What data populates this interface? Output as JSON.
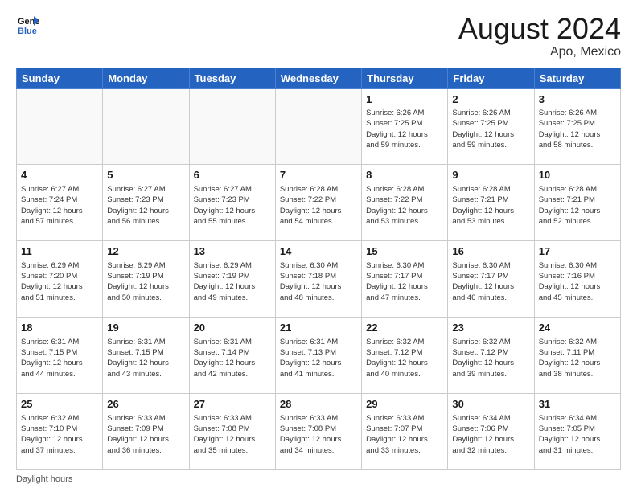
{
  "header": {
    "logo_line1": "General",
    "logo_line2": "Blue",
    "month_year": "August 2024",
    "location": "Apo, Mexico"
  },
  "footer": {
    "daylight_label": "Daylight hours"
  },
  "days_of_week": [
    "Sunday",
    "Monday",
    "Tuesday",
    "Wednesday",
    "Thursday",
    "Friday",
    "Saturday"
  ],
  "weeks": [
    [
      {
        "num": "",
        "info": ""
      },
      {
        "num": "",
        "info": ""
      },
      {
        "num": "",
        "info": ""
      },
      {
        "num": "",
        "info": ""
      },
      {
        "num": "1",
        "info": "Sunrise: 6:26 AM\nSunset: 7:25 PM\nDaylight: 12 hours\nand 59 minutes."
      },
      {
        "num": "2",
        "info": "Sunrise: 6:26 AM\nSunset: 7:25 PM\nDaylight: 12 hours\nand 59 minutes."
      },
      {
        "num": "3",
        "info": "Sunrise: 6:26 AM\nSunset: 7:25 PM\nDaylight: 12 hours\nand 58 minutes."
      }
    ],
    [
      {
        "num": "4",
        "info": "Sunrise: 6:27 AM\nSunset: 7:24 PM\nDaylight: 12 hours\nand 57 minutes."
      },
      {
        "num": "5",
        "info": "Sunrise: 6:27 AM\nSunset: 7:23 PM\nDaylight: 12 hours\nand 56 minutes."
      },
      {
        "num": "6",
        "info": "Sunrise: 6:27 AM\nSunset: 7:23 PM\nDaylight: 12 hours\nand 55 minutes."
      },
      {
        "num": "7",
        "info": "Sunrise: 6:28 AM\nSunset: 7:22 PM\nDaylight: 12 hours\nand 54 minutes."
      },
      {
        "num": "8",
        "info": "Sunrise: 6:28 AM\nSunset: 7:22 PM\nDaylight: 12 hours\nand 53 minutes."
      },
      {
        "num": "9",
        "info": "Sunrise: 6:28 AM\nSunset: 7:21 PM\nDaylight: 12 hours\nand 53 minutes."
      },
      {
        "num": "10",
        "info": "Sunrise: 6:28 AM\nSunset: 7:21 PM\nDaylight: 12 hours\nand 52 minutes."
      }
    ],
    [
      {
        "num": "11",
        "info": "Sunrise: 6:29 AM\nSunset: 7:20 PM\nDaylight: 12 hours\nand 51 minutes."
      },
      {
        "num": "12",
        "info": "Sunrise: 6:29 AM\nSunset: 7:19 PM\nDaylight: 12 hours\nand 50 minutes."
      },
      {
        "num": "13",
        "info": "Sunrise: 6:29 AM\nSunset: 7:19 PM\nDaylight: 12 hours\nand 49 minutes."
      },
      {
        "num": "14",
        "info": "Sunrise: 6:30 AM\nSunset: 7:18 PM\nDaylight: 12 hours\nand 48 minutes."
      },
      {
        "num": "15",
        "info": "Sunrise: 6:30 AM\nSunset: 7:17 PM\nDaylight: 12 hours\nand 47 minutes."
      },
      {
        "num": "16",
        "info": "Sunrise: 6:30 AM\nSunset: 7:17 PM\nDaylight: 12 hours\nand 46 minutes."
      },
      {
        "num": "17",
        "info": "Sunrise: 6:30 AM\nSunset: 7:16 PM\nDaylight: 12 hours\nand 45 minutes."
      }
    ],
    [
      {
        "num": "18",
        "info": "Sunrise: 6:31 AM\nSunset: 7:15 PM\nDaylight: 12 hours\nand 44 minutes."
      },
      {
        "num": "19",
        "info": "Sunrise: 6:31 AM\nSunset: 7:15 PM\nDaylight: 12 hours\nand 43 minutes."
      },
      {
        "num": "20",
        "info": "Sunrise: 6:31 AM\nSunset: 7:14 PM\nDaylight: 12 hours\nand 42 minutes."
      },
      {
        "num": "21",
        "info": "Sunrise: 6:31 AM\nSunset: 7:13 PM\nDaylight: 12 hours\nand 41 minutes."
      },
      {
        "num": "22",
        "info": "Sunrise: 6:32 AM\nSunset: 7:12 PM\nDaylight: 12 hours\nand 40 minutes."
      },
      {
        "num": "23",
        "info": "Sunrise: 6:32 AM\nSunset: 7:12 PM\nDaylight: 12 hours\nand 39 minutes."
      },
      {
        "num": "24",
        "info": "Sunrise: 6:32 AM\nSunset: 7:11 PM\nDaylight: 12 hours\nand 38 minutes."
      }
    ],
    [
      {
        "num": "25",
        "info": "Sunrise: 6:32 AM\nSunset: 7:10 PM\nDaylight: 12 hours\nand 37 minutes."
      },
      {
        "num": "26",
        "info": "Sunrise: 6:33 AM\nSunset: 7:09 PM\nDaylight: 12 hours\nand 36 minutes."
      },
      {
        "num": "27",
        "info": "Sunrise: 6:33 AM\nSunset: 7:08 PM\nDaylight: 12 hours\nand 35 minutes."
      },
      {
        "num": "28",
        "info": "Sunrise: 6:33 AM\nSunset: 7:08 PM\nDaylight: 12 hours\nand 34 minutes."
      },
      {
        "num": "29",
        "info": "Sunrise: 6:33 AM\nSunset: 7:07 PM\nDaylight: 12 hours\nand 33 minutes."
      },
      {
        "num": "30",
        "info": "Sunrise: 6:34 AM\nSunset: 7:06 PM\nDaylight: 12 hours\nand 32 minutes."
      },
      {
        "num": "31",
        "info": "Sunrise: 6:34 AM\nSunset: 7:05 PM\nDaylight: 12 hours\nand 31 minutes."
      }
    ]
  ]
}
